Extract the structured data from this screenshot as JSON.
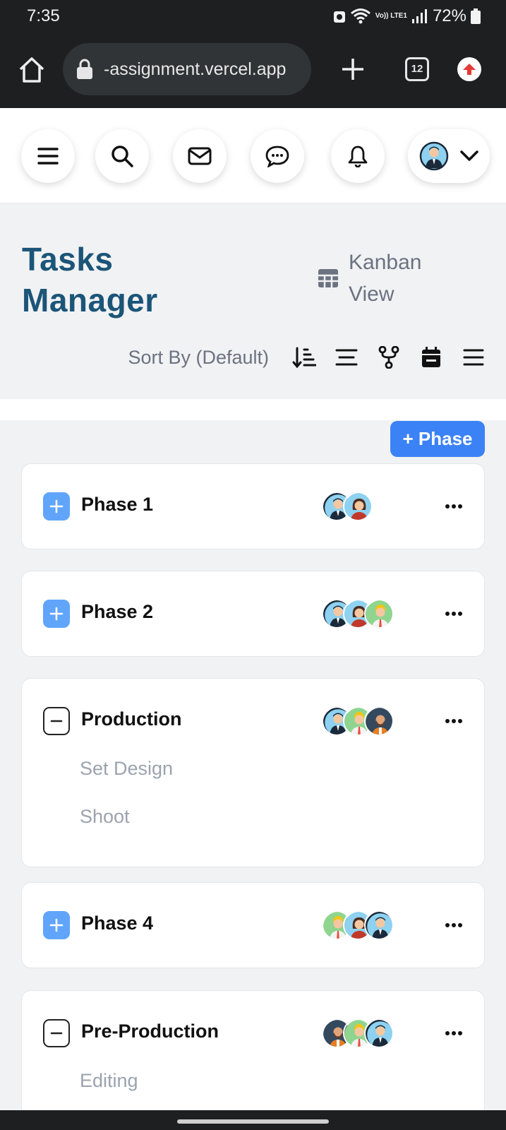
{
  "status_bar": {
    "time": "7:35",
    "network": "Vo)) LTE1",
    "battery": "72%"
  },
  "browser": {
    "url": "-assignment.vercel.app",
    "tab_count": "12"
  },
  "header": {
    "icons": [
      "menu-icon",
      "search-icon",
      "mail-icon",
      "chat-icon",
      "bell-icon",
      "avatar",
      "chevron-down-icon"
    ]
  },
  "page": {
    "title": "Tasks Manager",
    "view_toggle": "Kanban View",
    "sort_label": "Sort By (Default)",
    "add_phase": "+ Phase"
  },
  "phases": [
    {
      "name": "Phase 1",
      "expanded": false,
      "avatars": [
        "man-blue",
        "woman-red"
      ],
      "subtasks": []
    },
    {
      "name": "Phase 2",
      "expanded": false,
      "avatars": [
        "man-blue",
        "woman-red",
        "man-blond"
      ],
      "subtasks": []
    },
    {
      "name": "Production",
      "expanded": true,
      "avatars": [
        "man-blue",
        "man-blond",
        "man-beard"
      ],
      "subtasks": [
        "Set Design",
        "Shoot"
      ]
    },
    {
      "name": "Phase 4",
      "expanded": false,
      "avatars": [
        "man-blond",
        "woman-red",
        "man-blue"
      ],
      "subtasks": []
    },
    {
      "name": "Pre-Production",
      "expanded": true,
      "avatars": [
        "man-beard",
        "man-blond",
        "man-blue"
      ],
      "subtasks": [
        "Editing"
      ]
    }
  ],
  "colors": {
    "title": "#1b5578",
    "accent": "#3b82f6",
    "toggle_plus": "#60a5fa",
    "muted": "#9aa3ae"
  }
}
